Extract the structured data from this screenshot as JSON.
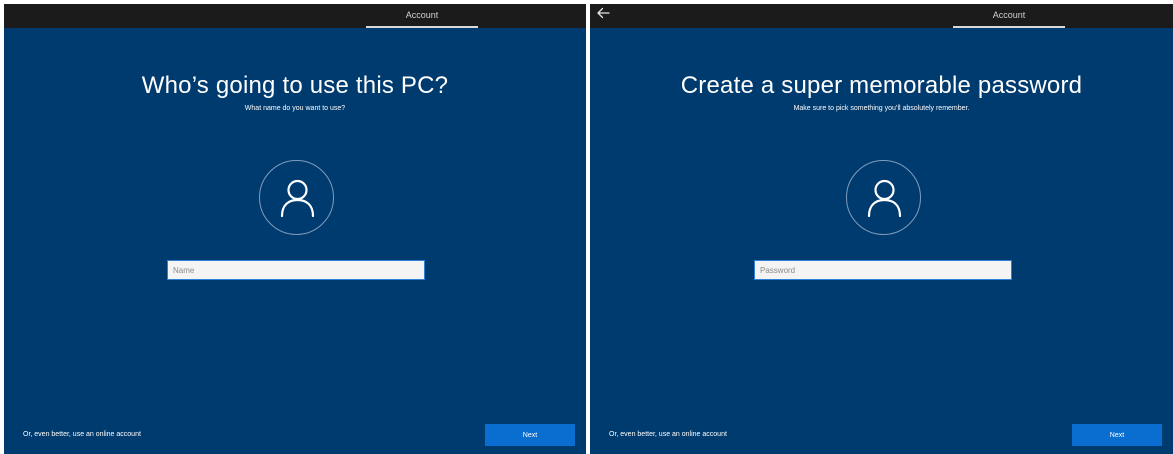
{
  "left": {
    "tab_label": "Account",
    "title": "Who’s going to use this PC?",
    "subtitle": "What name do you want to use?",
    "input_placeholder": "Name",
    "online_link": "Or, even better, use an online account",
    "next_label": "Next",
    "avatar_icon": "person-icon"
  },
  "right": {
    "back_icon": "back-arrow-icon",
    "tab_label": "Account",
    "title": "Create a super memorable password",
    "subtitle": "Make sure to pick something you’ll absolutely remember.",
    "input_placeholder": "Password",
    "online_link": "Or, even better, use an online account",
    "next_label": "Next",
    "avatar_icon": "person-icon"
  },
  "colors": {
    "background": "#003b6f",
    "topbar": "#1b1b1b",
    "accent": "#0a6ed1",
    "field_border": "#2f7fd6"
  }
}
